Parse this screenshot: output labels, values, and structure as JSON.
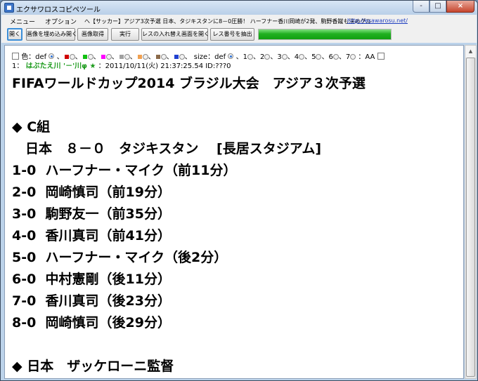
{
  "window": {
    "title": "エクサワロスコピペツール",
    "controls": [
      "-",
      "□",
      "×"
    ]
  },
  "menu": {
    "items": [
      "メニュー",
      "オプション"
    ],
    "thread_title": "へ【サッカー】アジア3次予選 日本、タジキスタンに8－0圧勝！ ハーフナー香川岡崎が2発、駒野香蹴も決めグル",
    "link": "http://exawarosu.net/"
  },
  "toolbar": {
    "buttons": [
      "開く",
      "画像を埋め込み開く",
      "画像取得",
      "実行",
      "レスの入れ替え画面を開く",
      "レス番号を抽出"
    ],
    "progress": 1.0
  },
  "options": {
    "color_label": "色：def",
    "swatch_colors": [
      "#d00000",
      "#10c010",
      "#ff00ff",
      "#a0a0a0",
      "#f0a050",
      "#8b6a4a",
      "#2040d0"
    ],
    "size_label": "size：def",
    "size_values": [
      "1",
      "2",
      "3",
      "4",
      "5",
      "6",
      "7"
    ],
    "aa_label": "：AA"
  },
  "post": {
    "number": "1：",
    "name": "はぶたえ川 '－'川φ ★",
    "meta": "：2011/10/11(火) 21:37:25.54 ID:???0",
    "lines": [
      "FIFAワールドカップ2014 ブラジル大会　アジア３次予選",
      "",
      "◆ C組",
      "　日本　８－０　タジキスタン　 [長居スタジアム]",
      "1-0  ハーフナー・マイク（前11分）",
      "2-0  岡崎慎司（前19分）",
      "3-0  駒野友一（前35分）",
      "4-0  香川真司（前41分）",
      "5-0  ハーフナー・マイク（後2分）",
      "6-0  中村憲剛（後11分）",
      "7-0  香川真司（後23分）",
      "8-0  岡崎慎司（後29分）",
      "",
      "◆ 日本　ザッケローニ監督"
    ]
  }
}
